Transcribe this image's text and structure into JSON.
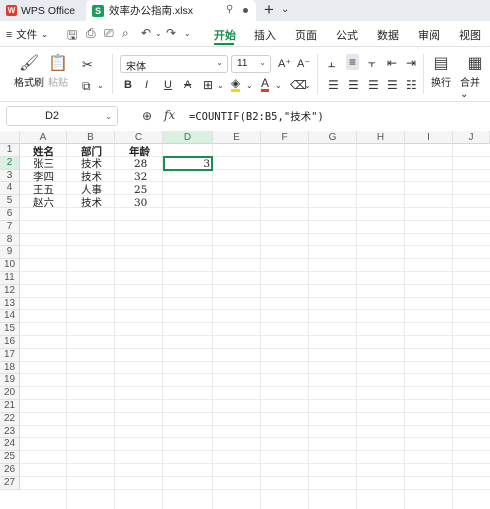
{
  "titlebar": {
    "app_name": "WPS Office",
    "app_logo": "W",
    "file_logo": "S",
    "file_name": "效率办公指南.xlsx",
    "pin_icon": "pin-icon",
    "add_tab": "+"
  },
  "menu": {
    "file_label": "文件",
    "tabs": [
      "开始",
      "插入",
      "页面",
      "公式",
      "数据",
      "审阅",
      "视图"
    ],
    "active_tab": "开始"
  },
  "ribbon": {
    "format_painter": "格式刷",
    "paste": "粘贴",
    "font_name": "宋体",
    "font_size": "11",
    "wrap": "换行",
    "merge": "合并",
    "bold": "B",
    "italic": "I",
    "underline": "U",
    "strike": "A",
    "font_color_letter": "A",
    "accent": "#1a8e4f",
    "font_color": "#e03b2e",
    "highlight_color": "#f5d800"
  },
  "formula_bar": {
    "name_box": "D2",
    "fx": "fx",
    "formula": "=COUNTIF(B2:B5,\"技术\")"
  },
  "sheet": {
    "columns": [
      "A",
      "B",
      "C",
      "D",
      "E",
      "F",
      "G",
      "H",
      "I",
      "J"
    ],
    "selected_column": "D",
    "rows": [
      "1",
      "2",
      "3",
      "4",
      "5",
      "6",
      "7",
      "8",
      "9",
      "10",
      "11",
      "12",
      "13",
      "14",
      "15",
      "16",
      "17",
      "18",
      "19",
      "20",
      "21",
      "22",
      "23",
      "24",
      "25",
      "26",
      "27"
    ],
    "selected_row": "2",
    "headers": [
      "姓名",
      "部门",
      "年龄"
    ],
    "data": [
      [
        "张三",
        "技术",
        "28"
      ],
      [
        "李四",
        "技术",
        "32"
      ],
      [
        "王五",
        "人事",
        "25"
      ],
      [
        "赵六",
        "技术",
        "30"
      ]
    ],
    "d2_value": "3"
  }
}
